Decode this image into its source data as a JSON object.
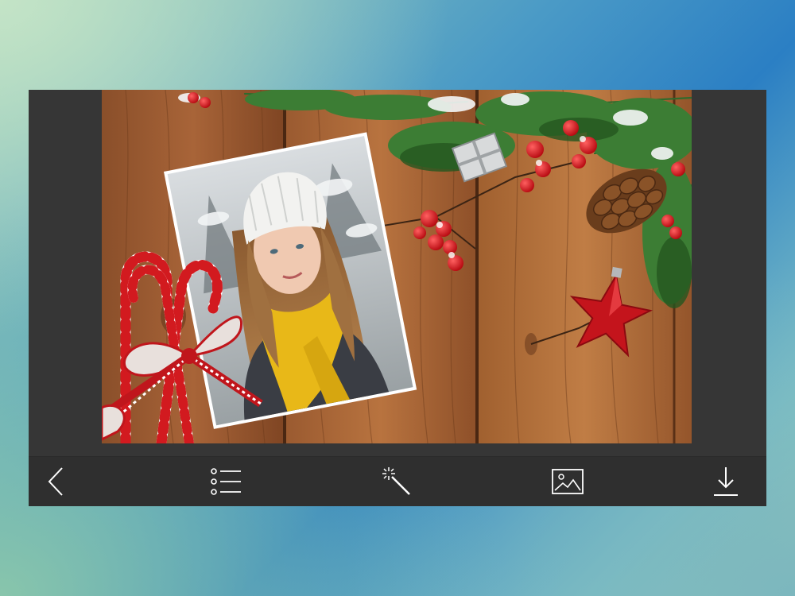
{
  "app": {
    "frame_color": "#363636",
    "toolbar_color": "#2f2f2f",
    "icon_color": "#ffffff"
  },
  "canvas": {
    "content": "christmas-photo-frame",
    "background": "wooden-planks",
    "inset_photo": "woman-in-yellow-scarf-and-white-hat",
    "decorations": [
      "pine-branches",
      "red-berries",
      "candy-canes",
      "red-ribbon-bow",
      "pine-cone",
      "red-star-ornament",
      "silver-gift-ornament"
    ]
  },
  "toolbar": {
    "buttons": [
      {
        "icon": "chevron-left-icon"
      },
      {
        "icon": "list-icon"
      },
      {
        "icon": "magic-wand-icon"
      },
      {
        "icon": "image-icon"
      },
      {
        "icon": "download-icon"
      }
    ]
  }
}
